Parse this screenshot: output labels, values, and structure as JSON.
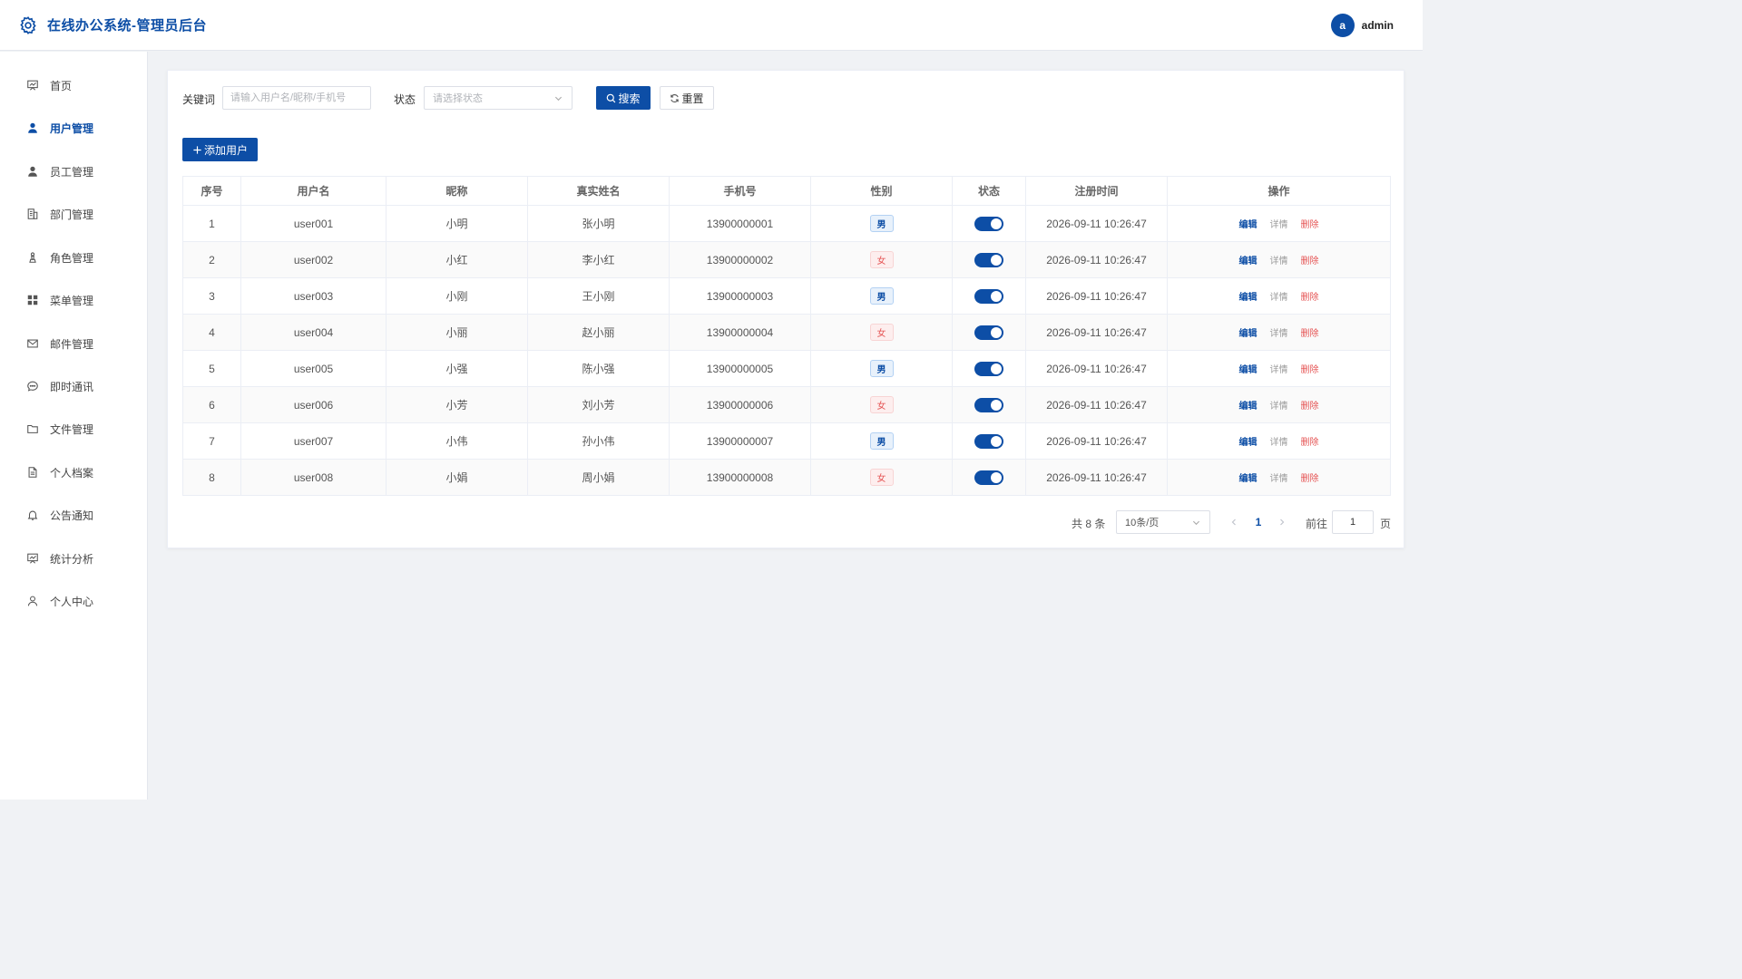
{
  "header": {
    "title": "在线办公系统-管理员后台",
    "avatar_letter": "a",
    "username": "admin"
  },
  "sidebar": {
    "items": [
      {
        "label": "首页",
        "icon": "chart-board-icon"
      },
      {
        "label": "用户管理",
        "icon": "user-filled-icon",
        "active": true
      },
      {
        "label": "员工管理",
        "icon": "user-filled-icon"
      },
      {
        "label": "部门管理",
        "icon": "building-icon"
      },
      {
        "label": "角色管理",
        "icon": "chess-piece-icon"
      },
      {
        "label": "菜单管理",
        "icon": "grid-icon"
      },
      {
        "label": "邮件管理",
        "icon": "mail-icon"
      },
      {
        "label": "即时通讯",
        "icon": "chat-bubble-icon"
      },
      {
        "label": "文件管理",
        "icon": "folder-icon"
      },
      {
        "label": "个人档案",
        "icon": "document-icon"
      },
      {
        "label": "公告通知",
        "icon": "bell-icon"
      },
      {
        "label": "统计分析",
        "icon": "chart-board-icon"
      },
      {
        "label": "个人中心",
        "icon": "user-outline-icon"
      }
    ]
  },
  "filters": {
    "keyword_label": "关键词",
    "keyword_placeholder": "请输入用户名/昵称/手机号",
    "status_label": "状态",
    "status_placeholder": "请选择状态",
    "search_label": "搜索",
    "reset_label": "重置"
  },
  "toolbar": {
    "add_label": "添加用户"
  },
  "table": {
    "columns": [
      "序号",
      "用户名",
      "昵称",
      "真实姓名",
      "手机号",
      "性别",
      "状态",
      "注册时间",
      "操作"
    ],
    "rows": [
      {
        "index": "1",
        "username": "user001",
        "nickname": "小明",
        "realname": "张小明",
        "phone": "13900000001",
        "gender": "男",
        "status_on": true,
        "registered": "2026-09-11 10:26:47"
      },
      {
        "index": "2",
        "username": "user002",
        "nickname": "小红",
        "realname": "李小红",
        "phone": "13900000002",
        "gender": "女",
        "status_on": true,
        "registered": "2026-09-11 10:26:47"
      },
      {
        "index": "3",
        "username": "user003",
        "nickname": "小刚",
        "realname": "王小刚",
        "phone": "13900000003",
        "gender": "男",
        "status_on": true,
        "registered": "2026-09-11 10:26:47"
      },
      {
        "index": "4",
        "username": "user004",
        "nickname": "小丽",
        "realname": "赵小丽",
        "phone": "13900000004",
        "gender": "女",
        "status_on": true,
        "registered": "2026-09-11 10:26:47"
      },
      {
        "index": "5",
        "username": "user005",
        "nickname": "小强",
        "realname": "陈小强",
        "phone": "13900000005",
        "gender": "男",
        "status_on": true,
        "registered": "2026-09-11 10:26:47"
      },
      {
        "index": "6",
        "username": "user006",
        "nickname": "小芳",
        "realname": "刘小芳",
        "phone": "13900000006",
        "gender": "女",
        "status_on": true,
        "registered": "2026-09-11 10:26:47"
      },
      {
        "index": "7",
        "username": "user007",
        "nickname": "小伟",
        "realname": "孙小伟",
        "phone": "13900000007",
        "gender": "男",
        "status_on": true,
        "registered": "2026-09-11 10:26:47"
      },
      {
        "index": "8",
        "username": "user008",
        "nickname": "小娟",
        "realname": "周小娟",
        "phone": "13900000008",
        "gender": "女",
        "status_on": true,
        "registered": "2026-09-11 10:26:47"
      }
    ],
    "actions": {
      "edit": "编辑",
      "detail": "详情",
      "delete": "删除"
    }
  },
  "pagination": {
    "total_text": "共 8 条",
    "page_size": "10条/页",
    "current_page": "1",
    "goto_label": "前往",
    "goto_value": "1",
    "page_suffix": "页"
  },
  "colors": {
    "primary": "#0d4ea6",
    "danger": "#e55353",
    "background": "#f0f2f5"
  }
}
